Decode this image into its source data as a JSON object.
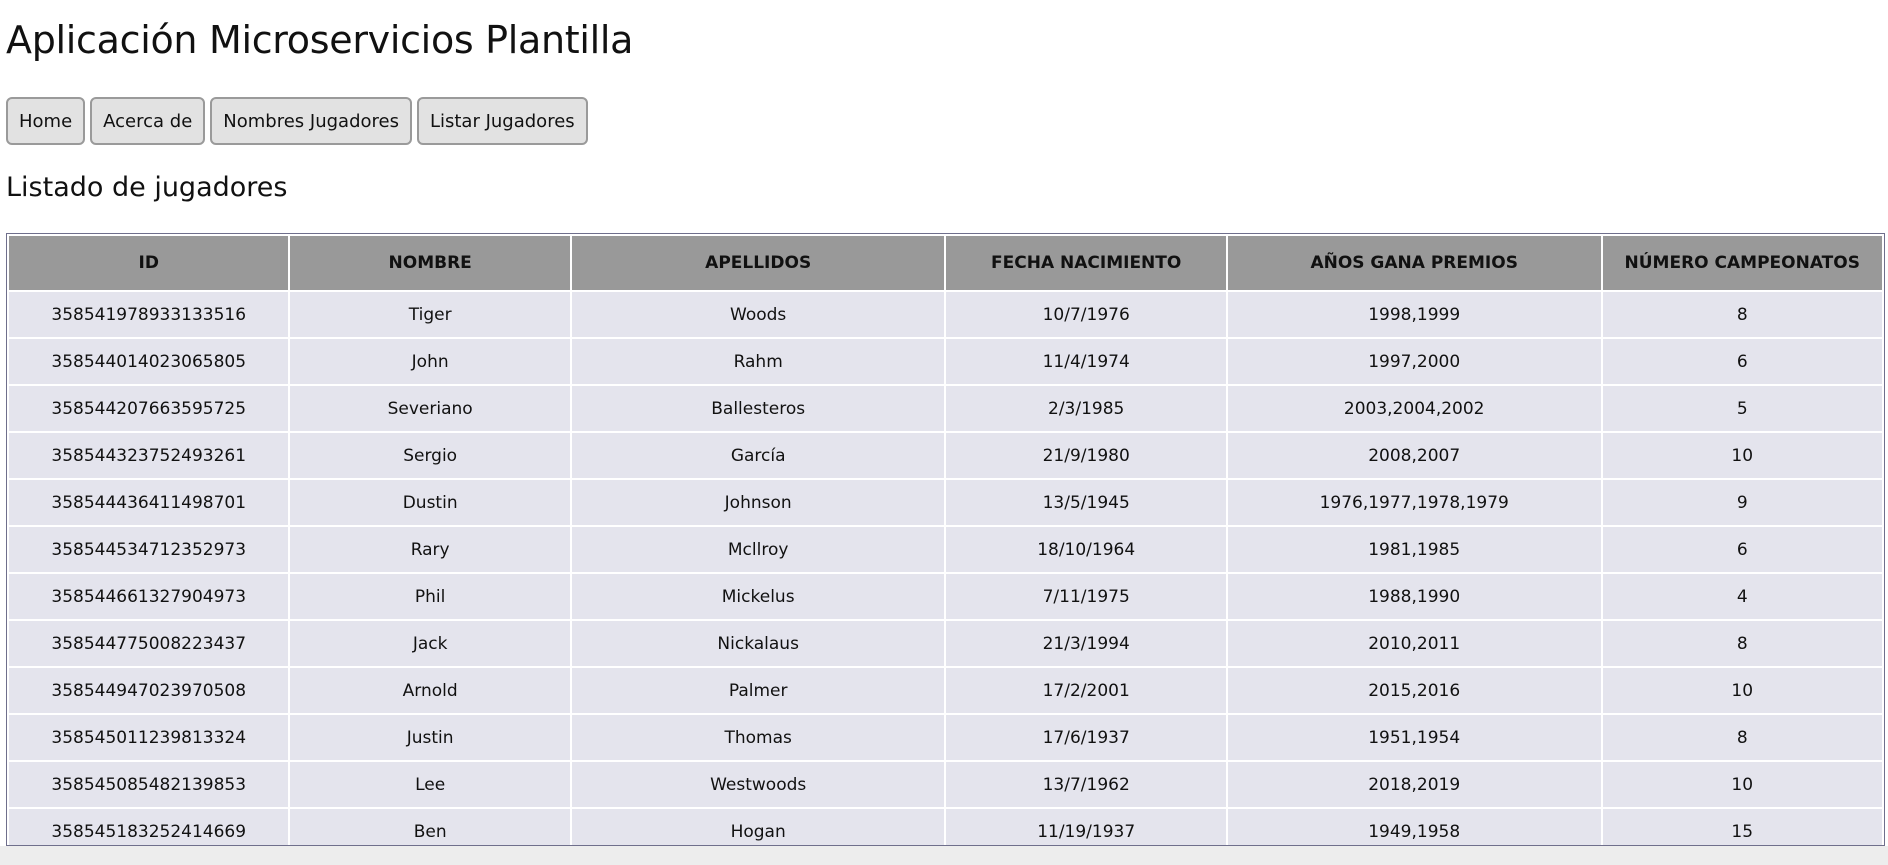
{
  "app": {
    "title": "Aplicación Microservicios Plantilla"
  },
  "nav": {
    "items": [
      {
        "label": "Home"
      },
      {
        "label": "Acerca de"
      },
      {
        "label": "Nombres Jugadores"
      },
      {
        "label": "Listar Jugadores"
      }
    ]
  },
  "page": {
    "heading": "Listado de jugadores"
  },
  "table": {
    "headers": [
      "ID",
      "NOMBRE",
      "APELLIDOS",
      "FECHA NACIMIENTO",
      "AÑOS GANA PREMIOS",
      "NÚMERO CAMPEONATOS"
    ],
    "rows": [
      [
        "358541978933133516",
        "Tiger",
        "Woods",
        "10/7/1976",
        "1998,1999",
        "8"
      ],
      [
        "358544014023065805",
        "John",
        "Rahm",
        "11/4/1974",
        "1997,2000",
        "6"
      ],
      [
        "358544207663595725",
        "Severiano",
        "Ballesteros",
        "2/3/1985",
        "2003,2004,2002",
        "5"
      ],
      [
        "358544323752493261",
        "Sergio",
        "García",
        "21/9/1980",
        "2008,2007",
        "10"
      ],
      [
        "358544436411498701",
        "Dustin",
        "Johnson",
        "13/5/1945",
        "1976,1977,1978,1979",
        "9"
      ],
      [
        "358544534712352973",
        "Rary",
        "Mcllroy",
        "18/10/1964",
        "1981,1985",
        "6"
      ],
      [
        "358544661327904973",
        "Phil",
        "Mickelus",
        "7/11/1975",
        "1988,1990",
        "4"
      ],
      [
        "358544775008223437",
        "Jack",
        "Nickalaus",
        "21/3/1994",
        "2010,2011",
        "8"
      ],
      [
        "358544947023970508",
        "Arnold",
        "Palmer",
        "17/2/2001",
        "2015,2016",
        "10"
      ],
      [
        "358545011239813324",
        "Justin",
        "Thomas",
        "17/6/1937",
        "1951,1954",
        "8"
      ],
      [
        "358545085482139853",
        "Lee",
        "Westwoods",
        "13/7/1962",
        "2018,2019",
        "10"
      ],
      [
        "358545183252414669",
        "Ben",
        "Hogan",
        "11/19/1937",
        "1949,1958",
        "15"
      ]
    ]
  }
}
